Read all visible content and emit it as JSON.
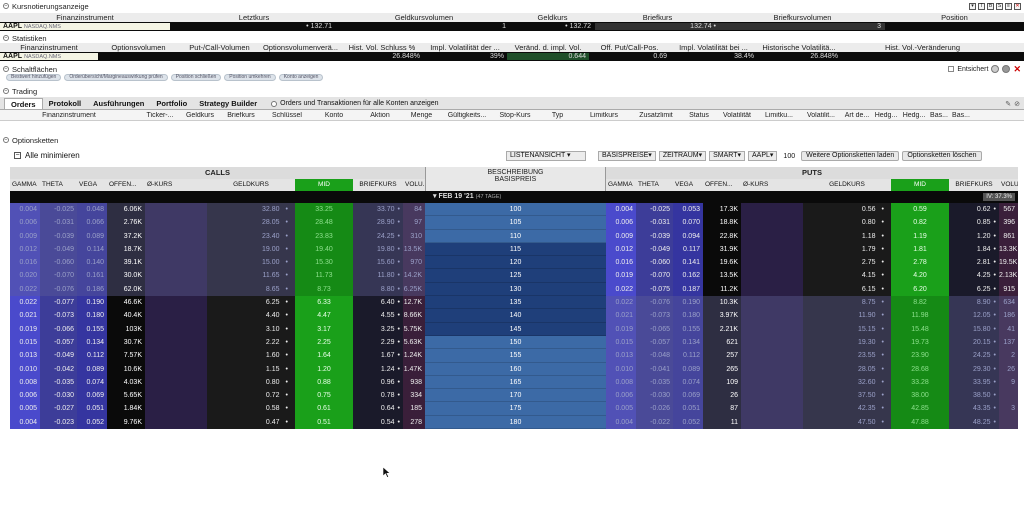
{
  "quote": {
    "section_title": "Kursnotierungsanzeige",
    "headers": [
      "Finanzinstrument",
      "Letztkurs",
      "Geldkursvolumen",
      "Geldkurs",
      "Briefkurs",
      "Briefkursvolumen",
      "Position"
    ],
    "symbol": "AAPL",
    "exchange": "NASDAQ.NMS",
    "last": "132.71",
    "bid_size": "1",
    "bid": "132.72",
    "ask": "132.74",
    "ask_size": "3",
    "position": ""
  },
  "stats": {
    "section_title": "Statistiken",
    "headers": [
      "Finanzinstrument",
      "Optionsvolumen",
      "Put-/Call-Volumen",
      "Optionsvolumenverä...",
      "Hist. Vol. Schluss %",
      "Impl. Volatilität der ...",
      "Veränd. d. impl. Vol.",
      "Off. Put/Call-Pos.",
      "Impl. Volatilität bei ...",
      "Historische Volatilitä...",
      "Hist. Vol.-Veränderung"
    ],
    "values": [
      "AAPL",
      "",
      "",
      "",
      "26.848%",
      "39%",
      "0.644",
      "0.69",
      "38.4%",
      "26.848%",
      ""
    ],
    "exchange": "NASDAQ.NMS"
  },
  "buttons": {
    "section_title": "Schaltflächen",
    "items": [
      "Bestwert hinzufügen",
      "Orderübersicht/Margineauswirkung prüfen",
      "Position schließen",
      "Position umkehren",
      "Konto anzeigen"
    ],
    "unlocked": "Entsichert"
  },
  "trading": {
    "section_title": "Trading",
    "tabs": [
      "Orders",
      "Protokoll",
      "Ausführungen",
      "Portfolio",
      "Strategy Builder"
    ],
    "all_accounts": "Orders und Transaktionen für alle Konten anzeigen",
    "columns": [
      "Finanzinstrument",
      "Ticker-...",
      "Geldkurs",
      "Briefkurs",
      "Schlüssel",
      "Konto",
      "Aktion",
      "Menge",
      "Gültigkeits...",
      "Stop-Kurs",
      "Typ",
      "Limitkurs",
      "Zusatzlimit",
      "Status",
      "Volatilität",
      "Limitku...",
      "Volatilit...",
      "Art de...",
      "Hedg...",
      "Hedg...",
      "Bas...",
      "Bas..."
    ]
  },
  "chains": {
    "section_title": "Optionsketten",
    "minimize": "Alle minimieren",
    "list_view": "LISTENANSICHT",
    "strikes": "BASISPREISE",
    "period": "ZEITRAUM",
    "smart": "SMART",
    "symbol": "AAPL",
    "count": "100",
    "load_btn": "Weitere Optionsketten laden",
    "delete_btn": "Optionsketten löschen",
    "calls_title": "CALLS",
    "puts_title": "PUTS",
    "desc_title": "BESCHREIBUNG",
    "strike_title": "BASISPREIS",
    "expiry": "FEB 19 '21",
    "expiry_days": "(47 TAGE)",
    "iv_label": "IV: 37.3%",
    "col_headers": [
      "GAMMA",
      "THETA",
      "VEGA",
      "OFFEN...",
      "Ø-KURS",
      "GELDKURS",
      "MID",
      "BRIEFKURS",
      "VOLU..."
    ],
    "strikes_list": [
      "100",
      "105",
      "110",
      "115",
      "120",
      "125",
      "130",
      "135",
      "140",
      "145",
      "150",
      "155",
      "160",
      "165",
      "170",
      "175",
      "180"
    ],
    "calls": [
      [
        "0.004",
        "-0.025",
        "0.048",
        "6.06K",
        "",
        "32.80",
        "33.25",
        "33.70",
        "84"
      ],
      [
        "0.006",
        "-0.031",
        "0.066",
        "2.76K",
        "",
        "28.05",
        "28.48",
        "28.90",
        "97"
      ],
      [
        "0.009",
        "-0.039",
        "0.089",
        "37.2K",
        "",
        "23.40",
        "23.83",
        "24.25",
        "310"
      ],
      [
        "0.012",
        "-0.049",
        "0.114",
        "18.7K",
        "",
        "19.00",
        "19.40",
        "19.80",
        "13.5K"
      ],
      [
        "0.016",
        "-0.060",
        "0.140",
        "39.1K",
        "",
        "15.00",
        "15.30",
        "15.60",
        "970"
      ],
      [
        "0.020",
        "-0.070",
        "0.161",
        "30.0K",
        "",
        "11.65",
        "11.73",
        "11.80",
        "14.2K"
      ],
      [
        "0.022",
        "-0.076",
        "0.186",
        "62.0K",
        "",
        "8.65",
        "8.73",
        "8.80",
        "6.25K"
      ],
      [
        "0.022",
        "-0.077",
        "0.190",
        "46.6K",
        "",
        "6.25",
        "6.33",
        "6.40",
        "12.7K"
      ],
      [
        "0.021",
        "-0.073",
        "0.180",
        "40.4K",
        "",
        "4.40",
        "4.47",
        "4.55",
        "8.66K"
      ],
      [
        "0.019",
        "-0.066",
        "0.155",
        "103K",
        "",
        "3.10",
        "3.17",
        "3.25",
        "5.75K"
      ],
      [
        "0.015",
        "-0.057",
        "0.134",
        "30.7K",
        "",
        "2.22",
        "2.25",
        "2.29",
        "5.63K"
      ],
      [
        "0.013",
        "-0.049",
        "0.112",
        "7.57K",
        "",
        "1.60",
        "1.64",
        "1.67",
        "1.24K"
      ],
      [
        "0.010",
        "-0.042",
        "0.089",
        "10.6K",
        "",
        "1.15",
        "1.20",
        "1.24",
        "1.47K"
      ],
      [
        "0.008",
        "-0.035",
        "0.074",
        "4.03K",
        "",
        "0.80",
        "0.88",
        "0.96",
        "938"
      ],
      [
        "0.006",
        "-0.030",
        "0.069",
        "5.65K",
        "",
        "0.72",
        "0.75",
        "0.78",
        "334"
      ],
      [
        "0.005",
        "-0.027",
        "0.051",
        "1.84K",
        "",
        "0.58",
        "0.61",
        "0.64",
        "185"
      ],
      [
        "0.004",
        "-0.023",
        "0.052",
        "9.76K",
        "",
        "0.47",
        "0.51",
        "0.54",
        "278"
      ]
    ],
    "puts": [
      [
        "0.004",
        "-0.025",
        "0.053",
        "17.3K",
        "",
        "0.56",
        "0.59",
        "0.62",
        "567"
      ],
      [
        "0.006",
        "-0.031",
        "0.070",
        "18.8K",
        "",
        "0.80",
        "0.82",
        "0.85",
        "396"
      ],
      [
        "0.009",
        "-0.039",
        "0.094",
        "22.8K",
        "",
        "1.18",
        "1.19",
        "1.20",
        "861"
      ],
      [
        "0.012",
        "-0.049",
        "0.117",
        "31.9K",
        "",
        "1.79",
        "1.81",
        "1.84",
        "13.3K"
      ],
      [
        "0.016",
        "-0.060",
        "0.141",
        "19.6K",
        "",
        "2.75",
        "2.78",
        "2.81",
        "19.5K"
      ],
      [
        "0.019",
        "-0.070",
        "0.162",
        "13.5K",
        "",
        "4.15",
        "4.20",
        "4.25",
        "2.13K"
      ],
      [
        "0.022",
        "-0.075",
        "0.187",
        "11.2K",
        "",
        "6.15",
        "6.20",
        "6.25",
        "915"
      ],
      [
        "0.022",
        "-0.076",
        "0.190",
        "10.3K",
        "",
        "8.75",
        "8.82",
        "8.90",
        "634"
      ],
      [
        "0.021",
        "-0.073",
        "0.180",
        "3.97K",
        "",
        "11.90",
        "11.98",
        "12.05",
        "186"
      ],
      [
        "0.019",
        "-0.065",
        "0.155",
        "2.21K",
        "",
        "15.15",
        "15.48",
        "15.80",
        "41"
      ],
      [
        "0.015",
        "-0.057",
        "0.134",
        "621",
        "",
        "19.30",
        "19.73",
        "20.15",
        "137"
      ],
      [
        "0.013",
        "-0.048",
        "0.112",
        "257",
        "",
        "23.55",
        "23.90",
        "24.25",
        "2"
      ],
      [
        "0.010",
        "-0.041",
        "0.089",
        "265",
        "",
        "28.05",
        "28.68",
        "29.30",
        "26"
      ],
      [
        "0.008",
        "-0.035",
        "0.074",
        "109",
        "",
        "32.60",
        "33.28",
        "33.95",
        "9"
      ],
      [
        "0.006",
        "-0.030",
        "0.069",
        "26",
        "",
        "37.50",
        "38.00",
        "38.50",
        ""
      ],
      [
        "0.005",
        "-0.026",
        "0.051",
        "87",
        "",
        "42.35",
        "42.85",
        "43.35",
        "3"
      ],
      [
        "0.004",
        "-0.022",
        "0.052",
        "11",
        "",
        "47.50",
        "47.88",
        "48.25",
        ""
      ]
    ]
  },
  "colors": {
    "gamma": "#4a4acc",
    "theta": "#3d3d99",
    "vega": "#3535a0",
    "offen": "#0a0a0a",
    "okurs": "#2a1f45",
    "geld": "#1a1a1a",
    "mid": "#1aa01a",
    "brief": "#1a1a2a",
    "volu": "#3a1f3a",
    "strike_dark": "#1f3f7a",
    "strike_light": "#3c6aa6"
  }
}
